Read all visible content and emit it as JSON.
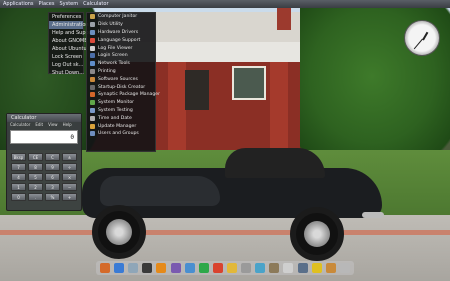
{
  "top_panel": {
    "applications": "Applications",
    "places": "Places",
    "system": "System",
    "calculator_launcher": "Calculator"
  },
  "system_menu": {
    "items": [
      {
        "label": "Preferences",
        "active": false
      },
      {
        "label": "Administration",
        "active": true
      },
      {
        "label": "Help and Support",
        "active": false
      },
      {
        "label": "About GNOME",
        "active": false
      },
      {
        "label": "About Ubuntu",
        "active": false
      },
      {
        "label": "Lock Screen",
        "active": false
      },
      {
        "label": "Log Out sk...",
        "active": false
      },
      {
        "label": "Shut Down...",
        "active": false
      }
    ]
  },
  "administration_submenu": {
    "items": [
      {
        "label": "Computer Janitor",
        "icon": "broom-icon",
        "color": "#c9a24a"
      },
      {
        "label": "Disk Utility",
        "icon": "disk-icon",
        "color": "#9aa0a8"
      },
      {
        "label": "Hardware Drivers",
        "icon": "chip-icon",
        "color": "#6b8fbf"
      },
      {
        "label": "Language Support",
        "icon": "flag-icon",
        "color": "#d94a3a"
      },
      {
        "label": "Log File Viewer",
        "icon": "document-icon",
        "color": "#cfcfcf"
      },
      {
        "label": "Login Screen",
        "icon": "monitor-icon",
        "color": "#4b6fa8"
      },
      {
        "label": "Network Tools",
        "icon": "network-icon",
        "color": "#5f8fc9"
      },
      {
        "label": "Printing",
        "icon": "printer-icon",
        "color": "#8a8a8a"
      },
      {
        "label": "Software Sources",
        "icon": "package-icon",
        "color": "#c98a3a"
      },
      {
        "label": "Startup-Disk Creator",
        "icon": "usb-icon",
        "color": "#6a6a6a"
      },
      {
        "label": "Synaptic Package Manager",
        "icon": "synaptic-icon",
        "color": "#d2662a"
      },
      {
        "label": "System Monitor",
        "icon": "chart-icon",
        "color": "#5fa84a"
      },
      {
        "label": "System Testing",
        "icon": "check-icon",
        "color": "#7a9bc9"
      },
      {
        "label": "Time and Date",
        "icon": "clock-icon",
        "color": "#b0b0b0"
      },
      {
        "label": "Update Manager",
        "icon": "update-icon",
        "color": "#d9a43a"
      },
      {
        "label": "Users and Groups",
        "icon": "users-icon",
        "color": "#6f8fbf"
      }
    ]
  },
  "calculator": {
    "title": "Calculator",
    "menu": [
      "Calculator",
      "Edit",
      "View",
      "Help"
    ],
    "display_value": "0",
    "buttons": [
      "Bksp",
      "CE",
      "C",
      "±",
      "7",
      "8",
      "9",
      "÷",
      "4",
      "5",
      "6",
      "×",
      "1",
      "2",
      "3",
      "−",
      "0",
      ".",
      "%",
      "+"
    ]
  },
  "dock": {
    "icons": [
      {
        "name": "home-folder-icon",
        "color": "#d46a2a"
      },
      {
        "name": "firefox-icon",
        "color": "#3a7bd5"
      },
      {
        "name": "files-icon",
        "color": "#8fa6b8"
      },
      {
        "name": "terminal-icon",
        "color": "#3a3a3a"
      },
      {
        "name": "vlc-icon",
        "color": "#e58a1a"
      },
      {
        "name": "pidgin-icon",
        "color": "#7a5ab0"
      },
      {
        "name": "mail-icon",
        "color": "#4a8fd0"
      },
      {
        "name": "music-icon",
        "color": "#2ea84a"
      },
      {
        "name": "chrome-icon",
        "color": "#d9432f"
      },
      {
        "name": "photos-icon",
        "color": "#e2b83a"
      },
      {
        "name": "settings-icon",
        "color": "#9a9a9a"
      },
      {
        "name": "chat-icon",
        "color": "#4aa3c9"
      },
      {
        "name": "gimp-icon",
        "color": "#8c7a5a"
      },
      {
        "name": "text-editor-icon",
        "color": "#cfcfcf"
      },
      {
        "name": "monitor-icon",
        "color": "#5a6f8a"
      },
      {
        "name": "game-icon",
        "color": "#e0c020"
      },
      {
        "name": "package-icon",
        "color": "#c98a3a"
      },
      {
        "name": "trash-icon",
        "color": "#b8b8b8"
      }
    ]
  }
}
